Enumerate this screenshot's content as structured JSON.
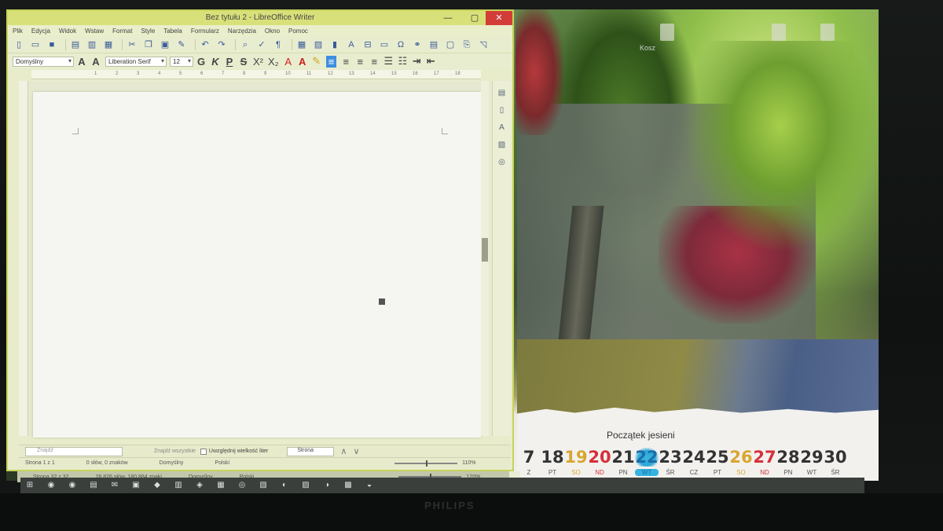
{
  "window": {
    "title": "Bez tytułu 2 - LibreOffice Writer",
    "close_glyph": "✕",
    "min_glyph": "—",
    "max_glyph": "▢"
  },
  "menu": [
    "Plik",
    "Edycja",
    "Widok",
    "Wstaw",
    "Format",
    "Style",
    "Tabela",
    "Formularz",
    "Narzędzia",
    "Okno",
    "Pomoc"
  ],
  "format_bar": {
    "paragraph_style": "Domyślny",
    "font_name": "Liberation Serif",
    "font_size": "12",
    "bold": "G",
    "italic": "K",
    "underline": "P",
    "strike": "S",
    "superscript": "X²",
    "subscript": "X₂"
  },
  "ruler_ticks": [
    "1",
    "2",
    "3",
    "4",
    "5",
    "6",
    "7",
    "8",
    "9",
    "10",
    "11",
    "12",
    "13",
    "14",
    "15",
    "16",
    "17",
    "18"
  ],
  "find_bar": {
    "placeholder": "Znajdź",
    "find_all": "Znajdź wszystkie",
    "match_case": "Uwzględnij wielkość liter",
    "search_type": "Strona"
  },
  "status_bar": {
    "page": "Strona 1 z 1",
    "words": "0 słów, 0 znaków",
    "style": "Domyślny",
    "language": "Polski",
    "zoom": "110%"
  },
  "status_bar_back": {
    "page": "Strona 32 z 32",
    "words": "28 826 słów, 180 884 znaki",
    "style": "Domyślny",
    "language": "Polski",
    "zoom": "120%"
  },
  "desktop": {
    "icon_label": "Kosz"
  },
  "calendar": {
    "title": "Początek jesieni",
    "days": [
      {
        "n": "7",
        "d": "Z",
        "kind": "normal"
      },
      {
        "n": "18",
        "d": "PT",
        "kind": "normal"
      },
      {
        "n": "19",
        "d": "SO",
        "kind": "sat"
      },
      {
        "n": "20",
        "d": "ND",
        "kind": "sun"
      },
      {
        "n": "21",
        "d": "PN",
        "kind": "normal"
      },
      {
        "n": "22",
        "d": "WT",
        "kind": "today"
      },
      {
        "n": "23",
        "d": "ŚR",
        "kind": "normal"
      },
      {
        "n": "24",
        "d": "CZ",
        "kind": "normal"
      },
      {
        "n": "25",
        "d": "PT",
        "kind": "normal"
      },
      {
        "n": "26",
        "d": "SO",
        "kind": "sat"
      },
      {
        "n": "27",
        "d": "ND",
        "kind": "sun"
      },
      {
        "n": "28",
        "d": "PN",
        "kind": "normal"
      },
      {
        "n": "29",
        "d": "WT",
        "kind": "normal"
      },
      {
        "n": "30",
        "d": "ŚR",
        "kind": "normal"
      }
    ]
  },
  "monitor_brand": "PHILIPS",
  "colors": {
    "writer_accent": "#c7d35a",
    "close_red": "#d33d38",
    "today_blue": "#35b2df",
    "weekend_sat": "#d9a530",
    "weekend_sun": "#d6303a"
  }
}
